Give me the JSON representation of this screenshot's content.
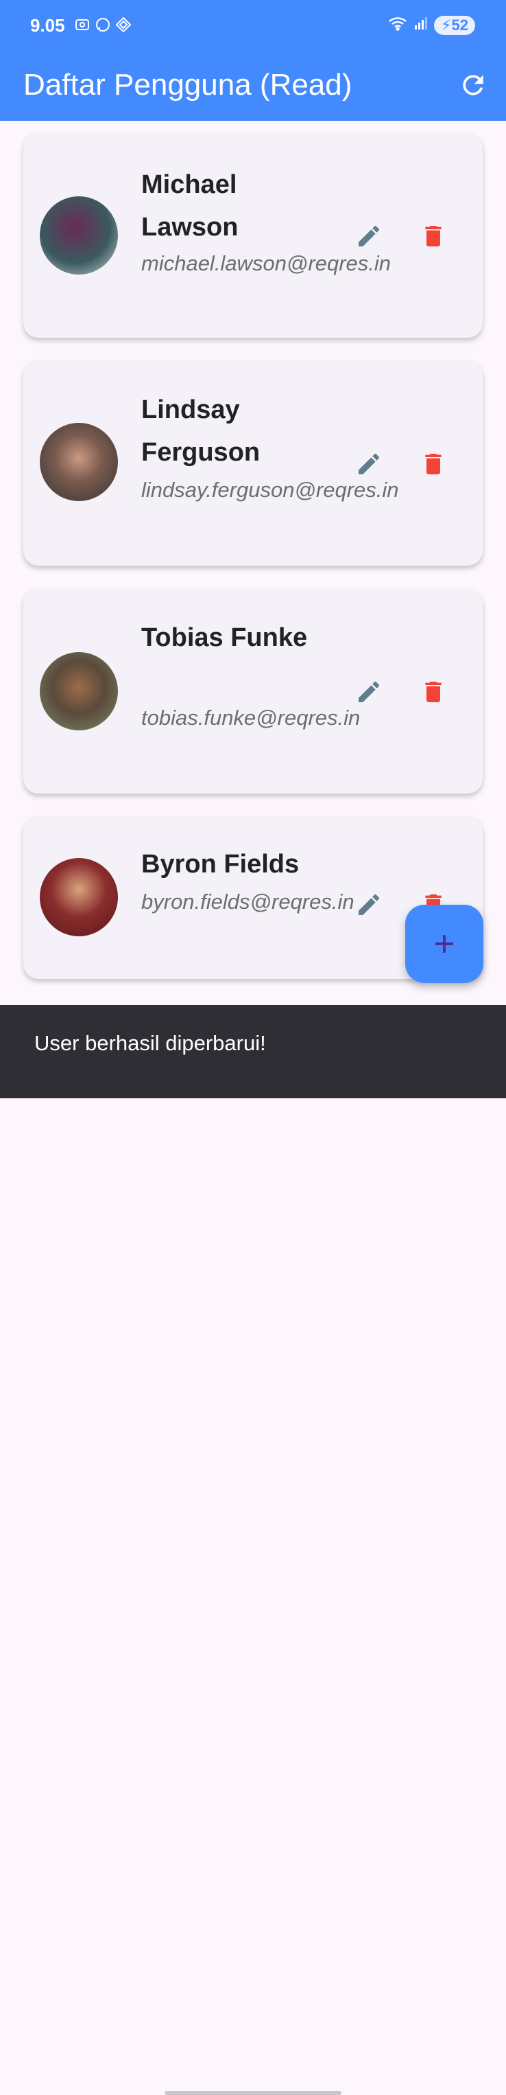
{
  "status_bar": {
    "time": "9.05",
    "battery": "52"
  },
  "app_bar": {
    "title": "Daftar Pengguna (Read)",
    "refresh_icon": "refresh-icon"
  },
  "users": [
    {
      "name": "Michael Lawson",
      "email": "michael.lawson@reqres.in"
    },
    {
      "name": "Lindsay Ferguson",
      "email": "lindsay.ferguson@reqres.in"
    },
    {
      "name": "Tobias Funke",
      "email": "tobias.funke@reqres.in"
    },
    {
      "name": "Byron Fields",
      "email": "byron.fields@reqres.in"
    }
  ],
  "fab": {
    "icon": "plus-icon"
  },
  "snackbar": {
    "message": "User berhasil diperbarui!"
  },
  "colors": {
    "primary": "#448aff",
    "delete": "#f44336",
    "edit": "#607d8b",
    "snackbar": "#302e35"
  }
}
